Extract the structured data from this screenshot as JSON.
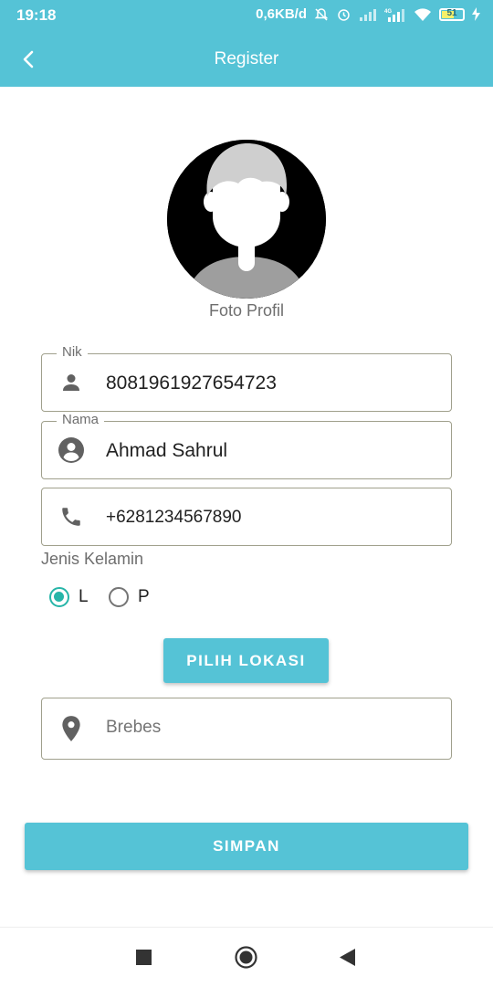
{
  "status_bar": {
    "time": "19:18",
    "network_speed": "0,6KB/d",
    "network_type": "4G",
    "battery": "51"
  },
  "app_bar": {
    "title": "Register",
    "back_icon": "arrow-back-icon"
  },
  "profile": {
    "photo_label": "Foto Profil"
  },
  "form": {
    "nik": {
      "label": "Nik",
      "value": "8081961927654723",
      "icon": "person-icon"
    },
    "nama": {
      "label": "Nama",
      "value": "Ahmad Sahrul",
      "icon": "account-circle-icon"
    },
    "phone": {
      "value": "+6281234567890",
      "icon": "phone-icon"
    },
    "gender": {
      "label": "Jenis Kelamin",
      "options": [
        {
          "label": "L",
          "selected": true
        },
        {
          "label": "P",
          "selected": false
        }
      ]
    },
    "pick_location_button": "PILIH LOKASI",
    "location": {
      "value": "Brebes",
      "icon": "location-pin-icon"
    },
    "save_button": "SIMPAN"
  },
  "colors": {
    "primary": "#55c3d6",
    "radio_accent": "#26b5a8",
    "field_border": "#a0a08c"
  }
}
